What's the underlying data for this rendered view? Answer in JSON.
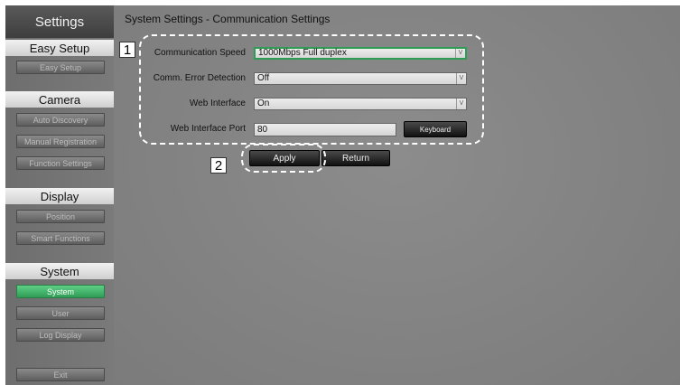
{
  "sidebar": {
    "title": "Settings",
    "sections": [
      {
        "heading": "Easy Setup",
        "items": [
          "Easy Setup"
        ]
      },
      {
        "heading": "Camera",
        "items": [
          "Auto Discovery",
          "Manual Registration",
          "Function Settings"
        ]
      },
      {
        "heading": "Display",
        "items": [
          "Position",
          "Smart Functions"
        ]
      },
      {
        "heading": "System",
        "items": [
          "System",
          "User",
          "Log Display"
        ]
      }
    ],
    "exit_label": "Exit"
  },
  "main": {
    "title": "System Settings - Communication Settings",
    "fields": {
      "comm_speed": {
        "label": "Communication Speed",
        "value": "1000Mbps Full duplex"
      },
      "comm_error": {
        "label": "Comm. Error Detection",
        "value": "Off"
      },
      "web_interface": {
        "label": "Web Interface",
        "value": "On"
      },
      "web_port": {
        "label": "Web Interface Port",
        "value": "80"
      }
    },
    "keyboard_label": "Keyboard",
    "apply_label": "Apply",
    "return_label": "Return"
  },
  "callouts": {
    "one": "1",
    "two": "2"
  },
  "colors": {
    "active_green": "#2f9c55",
    "callout": "#ffffff"
  }
}
